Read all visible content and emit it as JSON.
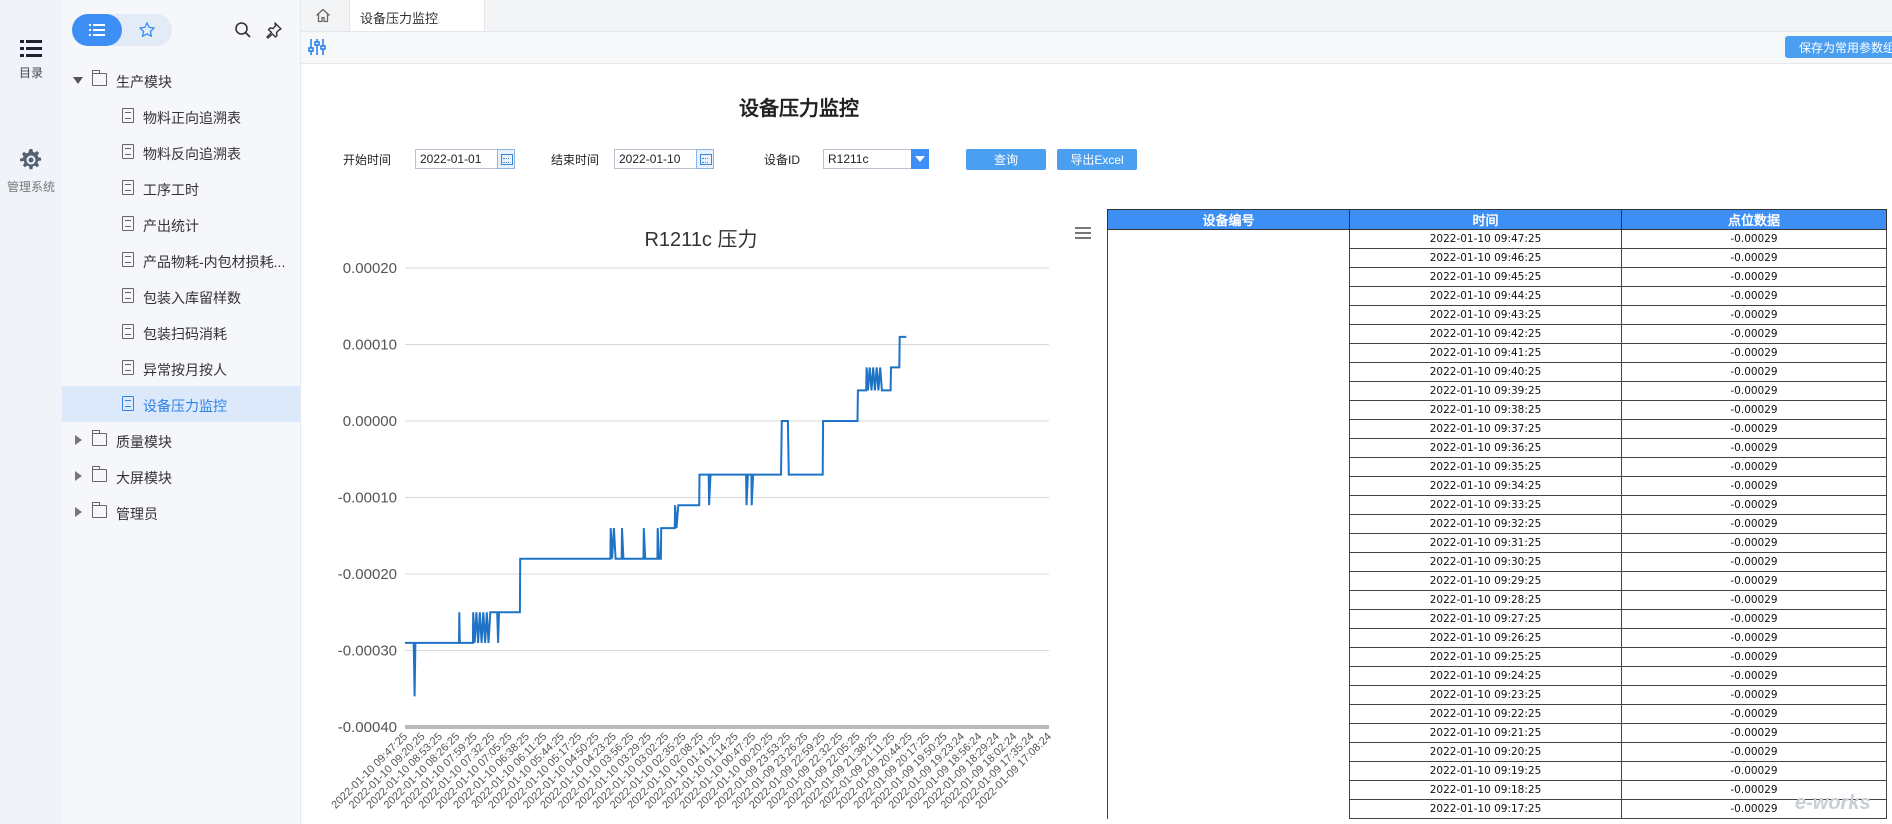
{
  "rail": {
    "catalog_label": "目录",
    "admin_label": "管理系统"
  },
  "nav": {
    "items": [
      {
        "label": "生产模块",
        "type": "folder",
        "expanded": true
      },
      {
        "label": "物料正向追溯表",
        "type": "doc"
      },
      {
        "label": "物料反向追溯表",
        "type": "doc"
      },
      {
        "label": "工序工时",
        "type": "doc"
      },
      {
        "label": "产出统计",
        "type": "doc"
      },
      {
        "label": "产品物耗-内包材损耗...",
        "type": "doc"
      },
      {
        "label": "包装入库留样数",
        "type": "doc"
      },
      {
        "label": "包装扫码消耗",
        "type": "doc"
      },
      {
        "label": "异常按月按人",
        "type": "doc"
      },
      {
        "label": "设备压力监控",
        "type": "doc",
        "active": true
      },
      {
        "label": "质量模块",
        "type": "folder",
        "expanded": false
      },
      {
        "label": "大屏模块",
        "type": "folder",
        "expanded": false
      },
      {
        "label": "管理员",
        "type": "folder",
        "expanded": false
      }
    ]
  },
  "tabs": {
    "active_label": "设备压力监控"
  },
  "toolbar": {
    "save_label": "保存为常用参数组"
  },
  "report": {
    "title": "设备压力监控"
  },
  "filters": {
    "start_label": "开始时间",
    "start_value": "2022-01-01",
    "end_label": "结束时间",
    "end_value": "2022-01-10",
    "device_label": "设备ID",
    "device_value": "R1211c",
    "query_label": "查询",
    "export_label": "导出Excel"
  },
  "colors": {
    "accent": "#3d8ff5",
    "line": "#1f73c7"
  },
  "chart_data": {
    "type": "line",
    "title": "R1211c 压力",
    "ylim": [
      -0.0004,
      0.0002
    ],
    "yticks": [
      "0.00020",
      "0.00010",
      "0.00000",
      "-0.00010",
      "-0.00020",
      "-0.00030",
      "-0.00040"
    ],
    "ytick_values": [
      0.0002,
      0.0001,
      0,
      -0.0001,
      -0.0002,
      -0.0003,
      -0.0004
    ],
    "grid": true,
    "xtick_labels": [
      "2022-01-10 09:47:25",
      "2022-01-10 09:20:25",
      "2022-01-10 08:53:25",
      "2022-01-10 08:26:25",
      "2022-01-10 07:59:25",
      "2022-01-10 07:32:25",
      "2022-01-10 07:05:25",
      "2022-01-10 06:38:25",
      "2022-01-10 06:11:25",
      "2022-01-10 05:44:25",
      "2022-01-10 05:17:25",
      "2022-01-10 04:50:25",
      "2022-01-10 04:23:25",
      "2022-01-10 03:56:25",
      "2022-01-10 03:29:25",
      "2022-01-10 03:02:25",
      "2022-01-10 02:35:25",
      "2022-01-10 02:08:25",
      "2022-01-10 01:41:25",
      "2022-01-10 01:14:25",
      "2022-01-10 00:47:25",
      "2022-01-10 00:20:25",
      "2022-01-09 23:53:25",
      "2022-01-09 23:26:25",
      "2022-01-09 22:59:25",
      "2022-01-09 22:32:25",
      "2022-01-09 22:05:25",
      "2022-01-09 21:38:25",
      "2022-01-09 21:11:25",
      "2022-01-09 20:44:25",
      "2022-01-09 20:17:25",
      "2022-01-09 19:50:25",
      "2022-01-09 19:23:24",
      "2022-01-09 18:56:24",
      "2022-01-09 18:29:24",
      "2022-01-09 18:02:24",
      "2022-01-09 17:35:24",
      "2022-01-09 17:08:24"
    ],
    "series": [
      {
        "points": [
          [
            0,
            -0.00029
          ],
          [
            0.5,
            -0.00029
          ],
          [
            0.55,
            -0.00036
          ],
          [
            0.6,
            -0.00029
          ],
          [
            3.1,
            -0.00029
          ],
          [
            3.12,
            -0.00025
          ],
          [
            3.15,
            -0.00029
          ],
          [
            3.9,
            -0.00029
          ],
          [
            3.92,
            -0.00025
          ],
          [
            4.0,
            -0.00029
          ],
          [
            4.1,
            -0.00025
          ],
          [
            4.2,
            -0.00029
          ],
          [
            4.3,
            -0.00025
          ],
          [
            4.4,
            -0.00029
          ],
          [
            4.5,
            -0.00025
          ],
          [
            4.6,
            -0.00029
          ],
          [
            4.7,
            -0.00025
          ],
          [
            4.8,
            -0.00029
          ],
          [
            4.9,
            -0.00025
          ],
          [
            5.3,
            -0.00025
          ],
          [
            5.35,
            -0.00029
          ],
          [
            5.4,
            -0.00025
          ],
          [
            6.6,
            -0.00025
          ],
          [
            6.62,
            -0.00018
          ],
          [
            11.8,
            -0.00018
          ],
          [
            11.82,
            -0.00014
          ],
          [
            11.9,
            -0.00018
          ],
          [
            12.0,
            -0.00014
          ],
          [
            12.1,
            -0.00018
          ],
          [
            12.45,
            -0.00018
          ],
          [
            12.47,
            -0.00014
          ],
          [
            12.55,
            -0.00018
          ],
          [
            13.7,
            -0.00018
          ],
          [
            13.72,
            -0.00014
          ],
          [
            13.8,
            -0.00018
          ],
          [
            14.5,
            -0.00018
          ],
          [
            14.52,
            -0.00014
          ],
          [
            14.6,
            -0.00018
          ],
          [
            14.7,
            -0.00018
          ],
          [
            14.72,
            -0.00014
          ],
          [
            15.5,
            -0.00014
          ],
          [
            15.52,
            -0.00011
          ],
          [
            15.6,
            -0.00014
          ],
          [
            15.7,
            -0.00011
          ],
          [
            16.9,
            -0.00011
          ],
          [
            16.92,
            -7e-05
          ],
          [
            17.45,
            -7e-05
          ],
          [
            17.47,
            -0.00011
          ],
          [
            17.55,
            -7e-05
          ],
          [
            19.6,
            -7e-05
          ],
          [
            19.62,
            -0.00011
          ],
          [
            19.7,
            -7e-05
          ],
          [
            19.9,
            -7e-05
          ],
          [
            19.92,
            -0.00011
          ],
          [
            20.0,
            -7e-05
          ],
          [
            21.6,
            -7e-05
          ],
          [
            21.65,
            0.0
          ],
          [
            22.0,
            0.0
          ],
          [
            22.05,
            -7e-05
          ],
          [
            24.0,
            -7e-05
          ],
          [
            24.02,
            0.0
          ],
          [
            26.0,
            0.0
          ],
          [
            26.02,
            4e-05
          ],
          [
            26.5,
            4e-05
          ],
          [
            26.52,
            7e-05
          ],
          [
            26.6,
            4e-05
          ],
          [
            26.7,
            7e-05
          ],
          [
            26.8,
            4e-05
          ],
          [
            26.9,
            7e-05
          ],
          [
            27.0,
            4e-05
          ],
          [
            27.1,
            7e-05
          ],
          [
            27.2,
            4e-05
          ],
          [
            27.3,
            7e-05
          ],
          [
            27.4,
            4e-05
          ],
          [
            27.9,
            4e-05
          ],
          [
            27.92,
            7e-05
          ],
          [
            28.4,
            7e-05
          ],
          [
            28.42,
            0.00011
          ],
          [
            28.8,
            0.00011
          ]
        ]
      }
    ]
  },
  "table": {
    "headers": [
      "设备编号",
      "时间",
      "点位数据"
    ],
    "rows": [
      [
        "2022-01-10 09:47:25",
        "-0.00029"
      ],
      [
        "2022-01-10 09:46:25",
        "-0.00029"
      ],
      [
        "2022-01-10 09:45:25",
        "-0.00029"
      ],
      [
        "2022-01-10 09:44:25",
        "-0.00029"
      ],
      [
        "2022-01-10 09:43:25",
        "-0.00029"
      ],
      [
        "2022-01-10 09:42:25",
        "-0.00029"
      ],
      [
        "2022-01-10 09:41:25",
        "-0.00029"
      ],
      [
        "2022-01-10 09:40:25",
        "-0.00029"
      ],
      [
        "2022-01-10 09:39:25",
        "-0.00029"
      ],
      [
        "2022-01-10 09:38:25",
        "-0.00029"
      ],
      [
        "2022-01-10 09:37:25",
        "-0.00029"
      ],
      [
        "2022-01-10 09:36:25",
        "-0.00029"
      ],
      [
        "2022-01-10 09:35:25",
        "-0.00029"
      ],
      [
        "2022-01-10 09:34:25",
        "-0.00029"
      ],
      [
        "2022-01-10 09:33:25",
        "-0.00029"
      ],
      [
        "2022-01-10 09:32:25",
        "-0.00029"
      ],
      [
        "2022-01-10 09:31:25",
        "-0.00029"
      ],
      [
        "2022-01-10 09:30:25",
        "-0.00029"
      ],
      [
        "2022-01-10 09:29:25",
        "-0.00029"
      ],
      [
        "2022-01-10 09:28:25",
        "-0.00029"
      ],
      [
        "2022-01-10 09:27:25",
        "-0.00029"
      ],
      [
        "2022-01-10 09:26:25",
        "-0.00029"
      ],
      [
        "2022-01-10 09:25:25",
        "-0.00029"
      ],
      [
        "2022-01-10 09:24:25",
        "-0.00029"
      ],
      [
        "2022-01-10 09:23:25",
        "-0.00029"
      ],
      [
        "2022-01-10 09:22:25",
        "-0.00029"
      ],
      [
        "2022-01-10 09:21:25",
        "-0.00029"
      ],
      [
        "2022-01-10 09:20:25",
        "-0.00029"
      ],
      [
        "2022-01-10 09:19:25",
        "-0.00029"
      ],
      [
        "2022-01-10 09:18:25",
        "-0.00029"
      ],
      [
        "2022-01-10 09:17:25",
        "-0.00029"
      ]
    ]
  },
  "watermark": "e-works"
}
